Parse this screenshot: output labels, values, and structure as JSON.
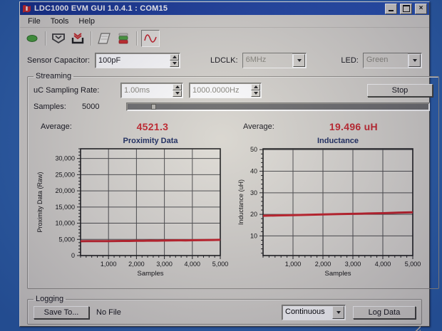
{
  "window": {
    "title": "LDC1000 EVM GUI 1.0.4.1 : COM15",
    "app_icon": "ti-logo-icon",
    "controls": [
      "minimize-icon",
      "maximize-icon",
      "close-icon"
    ]
  },
  "menu": {
    "items": [
      {
        "label": "File"
      },
      {
        "label": "Tools"
      },
      {
        "label": "Help"
      }
    ]
  },
  "toolbar": {
    "icons": [
      "connect-icon",
      "read-data-icon",
      "write-data-icon",
      "register-page-icon",
      "led-status-icon",
      "waveform-icon"
    ],
    "selected_icon": "waveform-icon"
  },
  "controls": {
    "sensor_capacitor_label": "Sensor Capacitor:",
    "sensor_capacitor_value": "100pF",
    "ldclk_label": "LDCLK:",
    "ldclk_value": "6MHz",
    "led_label": "LED:",
    "led_value": "Green"
  },
  "streaming": {
    "group_label": "Streaming",
    "sampling_rate_label": "uC Sampling Rate:",
    "sampling_rate_ms": "1.00ms",
    "sampling_rate_hz": "1000.0000Hz",
    "stop_button": "Stop",
    "samples_label": "Samples:",
    "samples_value": "5000",
    "progress_marker_percent": 8
  },
  "averages": {
    "proximity_label": "Average:",
    "proximity_value": "4521.3",
    "inductance_label": "Average:",
    "inductance_value": "19.496 uH"
  },
  "logging": {
    "group_label": "Logging",
    "save_to_button": "Save To...",
    "file_label": "No File",
    "mode_value": "Continuous",
    "log_button": "Log Data"
  },
  "colors": {
    "desktop_blue": "#2d61ad",
    "titlebar_blue": "#1c3f9f",
    "window_face": "#d8d5ce",
    "accent_red": "#c4252c",
    "chart_plot_bg": "#dedbd4",
    "chart_grid": "#4d4d4d",
    "chart_border": "#1c1c1c",
    "chart_title": "#1b2a5e",
    "chart_text": "#101010",
    "series_red": "#c32028"
  },
  "chart_data": [
    {
      "type": "line",
      "title": "Proximity Data",
      "xlabel": "Samples",
      "ylabel": "Proximity Data (Raw)",
      "xlim": [
        0,
        5000
      ],
      "ylim": [
        0,
        33000
      ],
      "grid": true,
      "x_ticks": [
        1000,
        2000,
        3000,
        4000,
        5000
      ],
      "x_tick_labels": [
        "1,000",
        "2,000",
        "3,000",
        "4,000",
        "5,000"
      ],
      "y_ticks": [
        0,
        5000,
        10000,
        15000,
        20000,
        25000,
        30000
      ],
      "y_tick_labels": [
        "0",
        "5,000",
        "10,000",
        "15,000",
        "20,000",
        "25,000",
        "30,000"
      ],
      "minor_x_step": 200,
      "minor_y_step": 1000,
      "series": [
        {
          "name": "proximity",
          "color": "#c32028",
          "x": [
            0,
            250,
            500,
            750,
            1000,
            1250,
            1500,
            1750,
            2000,
            2250,
            2500,
            2750,
            3000,
            3250,
            3500,
            3750,
            4000,
            4250,
            4500,
            4750,
            5000
          ],
          "y": [
            4430,
            4450,
            4440,
            4470,
            4460,
            4490,
            4520,
            4510,
            4560,
            4580,
            4610,
            4600,
            4640,
            4670,
            4700,
            4690,
            4730,
            4760,
            4780,
            4820,
            4870
          ]
        }
      ]
    },
    {
      "type": "line",
      "title": "Inductance",
      "xlabel": "Samples",
      "ylabel": "Inductance (uH)",
      "xlim": [
        0,
        5000
      ],
      "ylim": [
        0.9,
        50.4
      ],
      "grid": true,
      "x_ticks": [
        1000,
        2000,
        3000,
        4000,
        5000
      ],
      "x_tick_labels": [
        "1,000",
        "2,000",
        "3,000",
        "4,000",
        "5,000"
      ],
      "y_ticks": [
        10,
        20,
        30,
        40,
        50
      ],
      "y_tick_labels": [
        "10",
        "20",
        "30",
        "40",
        "50"
      ],
      "minor_x_step": 200,
      "minor_y_step": 2,
      "series": [
        {
          "name": "inductance",
          "color": "#c32028",
          "x": [
            0,
            500,
            1000,
            1500,
            2000,
            2500,
            3000,
            3500,
            4000,
            4500,
            5000
          ],
          "y": [
            19.35,
            19.5,
            19.65,
            19.8,
            19.95,
            20.1,
            20.25,
            20.4,
            20.55,
            20.75,
            20.95
          ]
        }
      ]
    }
  ]
}
